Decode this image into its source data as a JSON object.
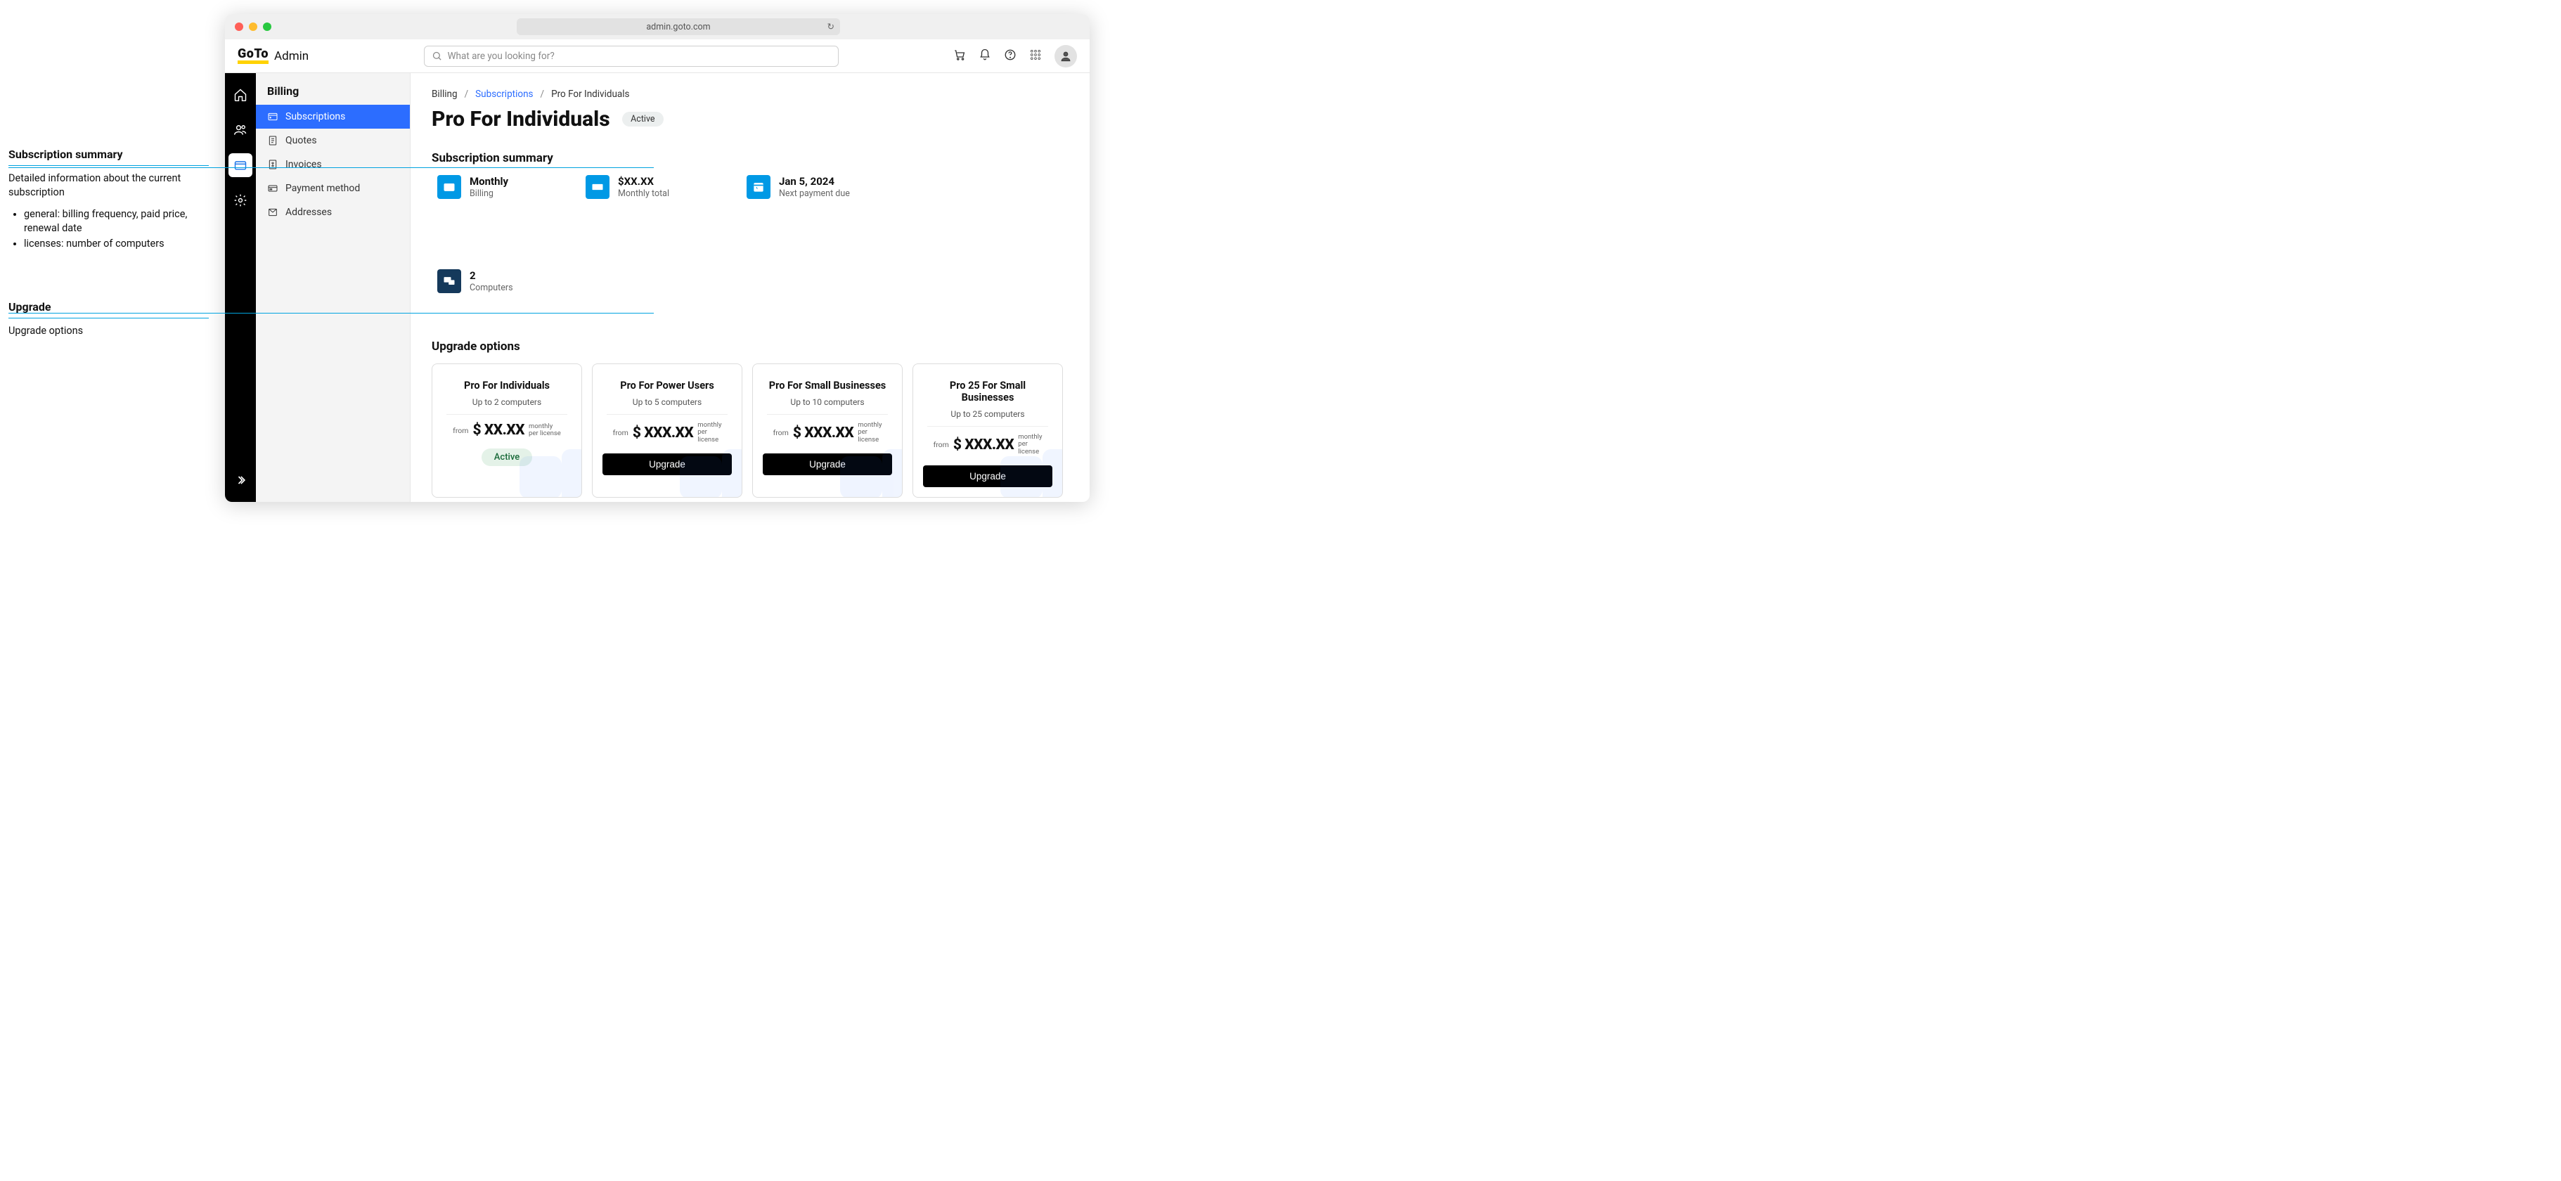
{
  "annotations": {
    "summary": {
      "title": "Subscription summary",
      "desc": "Detailed information about the current subscription",
      "bullets": [
        "general: billing frequency, paid price, renewal date",
        "licenses: number of computers"
      ]
    },
    "upgrade": {
      "title": "Upgrade",
      "desc": "Upgrade options"
    }
  },
  "browser": {
    "url": "admin.goto.com"
  },
  "header": {
    "logo_text": "GoTo",
    "app_name": "Admin",
    "search_placeholder": "What are you looking for?"
  },
  "sidebar": {
    "title": "Billing",
    "items": [
      {
        "label": "Subscriptions",
        "active": true
      },
      {
        "label": "Quotes"
      },
      {
        "label": "Invoices"
      },
      {
        "label": "Payment method"
      },
      {
        "label": "Addresses"
      }
    ]
  },
  "breadcrumbs": {
    "root": "Billing",
    "level1": "Subscriptions",
    "level2": "Pro For Individuals"
  },
  "page": {
    "title": "Pro For Individuals",
    "status": "Active"
  },
  "sections": {
    "summary_title": "Subscription summary",
    "upgrade_title": "Upgrade options"
  },
  "summary": {
    "billing": {
      "title": "Monthly",
      "sub": "Billing"
    },
    "total": {
      "title": "$XX.XX",
      "sub": "Monthly total"
    },
    "next": {
      "title": "Jan 5, 2024",
      "sub": "Next payment due"
    },
    "computers": {
      "title": "2",
      "sub": "Computers"
    }
  },
  "plans": [
    {
      "name": "Pro For Individuals",
      "cap": "Up to 2 computers",
      "from": "from",
      "price": "$ XX.XX",
      "unit1": "monthly",
      "unit2": "per license",
      "cta": "Active",
      "current": true
    },
    {
      "name": "Pro For Power Users",
      "cap": "Up to 5 computers",
      "from": "from",
      "price": "$ XXX.XX",
      "unit1": "monthly",
      "unit2": "per",
      "unit3": "license",
      "cta": "Upgrade",
      "current": false
    },
    {
      "name": "Pro For Small Businesses",
      "cap": "Up to 10 computers",
      "from": "from",
      "price": "$ XXX.XX",
      "unit1": "monthly",
      "unit2": "per",
      "unit3": "license",
      "cta": "Upgrade",
      "current": false
    },
    {
      "name": "Pro 25 For Small Businesses",
      "cap": "Up to 25 computers",
      "from": "from",
      "price": "$ XXX.XX",
      "unit1": "monthly",
      "unit2": "per",
      "unit3": "license",
      "cta": "Upgrade",
      "current": false
    }
  ]
}
